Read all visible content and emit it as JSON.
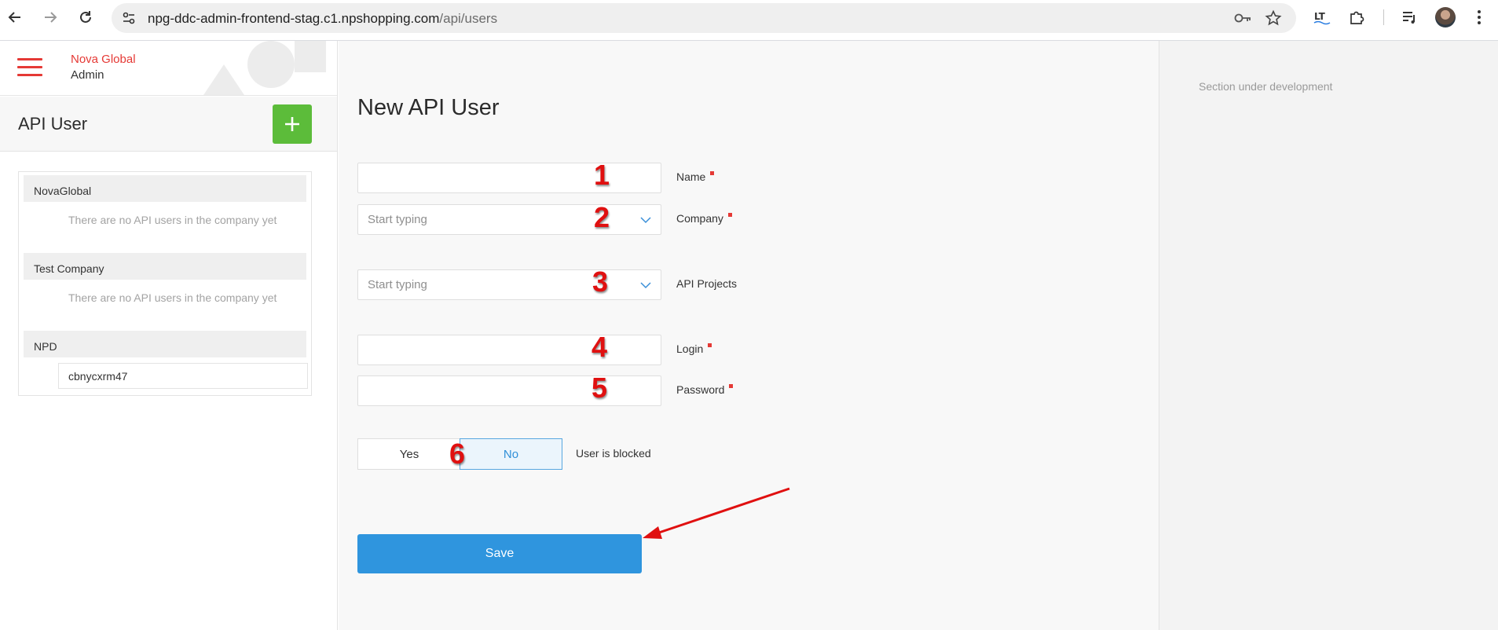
{
  "browser": {
    "url_host": "npg-ddc-admin-frontend-stag.c1.npshopping.com",
    "url_path": "/api/users"
  },
  "app": {
    "brand_line1": "Nova Global",
    "brand_line2": "Admin"
  },
  "sidebar": {
    "title": "API User",
    "groups": [
      {
        "name": "NovaGlobal",
        "empty_text": "There are no API users in the company yet"
      },
      {
        "name": "Test Company",
        "empty_text": "There are no API users in the company yet"
      },
      {
        "name": "NPD",
        "users": [
          "cbnycxrm47"
        ]
      }
    ]
  },
  "form": {
    "title": "New API User",
    "name_label": "Name",
    "company_label": "Company",
    "company_placeholder": "Start typing",
    "projects_label": "API Projects",
    "projects_placeholder": "Start typing",
    "login_label": "Login",
    "password_label": "Password",
    "blocked_label": "User is blocked",
    "blocked_yes": "Yes",
    "blocked_no": "No",
    "blocked_value": "No",
    "save_label": "Save"
  },
  "annotations": [
    "1",
    "2",
    "3",
    "4",
    "5",
    "6"
  ],
  "right_panel": {
    "note": "Section under development"
  },
  "colors": {
    "brand_red": "#e53935",
    "add_green": "#5cbc3a",
    "primary_blue": "#2f95de",
    "annotation_red": "#e01010"
  }
}
